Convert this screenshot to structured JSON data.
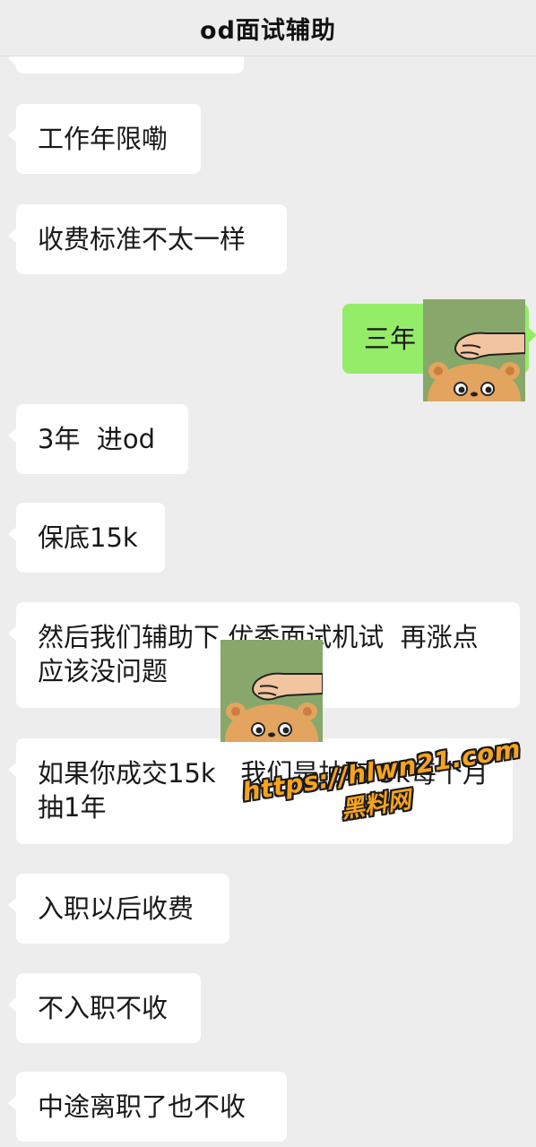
{
  "header": {
    "title": "od面试辅助"
  },
  "messages": [
    {
      "side": "left",
      "text": "工作年限嘞"
    },
    {
      "side": "left",
      "text": "收费标准不太一样"
    },
    {
      "side": "right",
      "text": "三年"
    },
    {
      "side": "left",
      "text": "3年  进od"
    },
    {
      "side": "left",
      "text": "保底15k"
    },
    {
      "side": "left",
      "text": "然后我们辅助下 优秀面试机试  再涨点应该没问题"
    },
    {
      "side": "left",
      "text": "如果你成交15k   我们是抽取 3k每个月  抽1年"
    },
    {
      "side": "left",
      "text": "入职以后收费"
    },
    {
      "side": "left",
      "text": "不入职不收"
    },
    {
      "side": "left",
      "text": "中途离职了也不收"
    }
  ],
  "stickers": [
    {
      "icon": "bear-head-pat-sticker-icon"
    },
    {
      "icon": "bear-head-pat-sticker-icon"
    }
  ],
  "watermark": {
    "url": "https://hlwn21.com",
    "name": "黑料网"
  },
  "colors": {
    "background": "#ededed",
    "bubble_left": "#ffffff",
    "bubble_right": "#95ec69",
    "watermark": "#f7a31c"
  }
}
